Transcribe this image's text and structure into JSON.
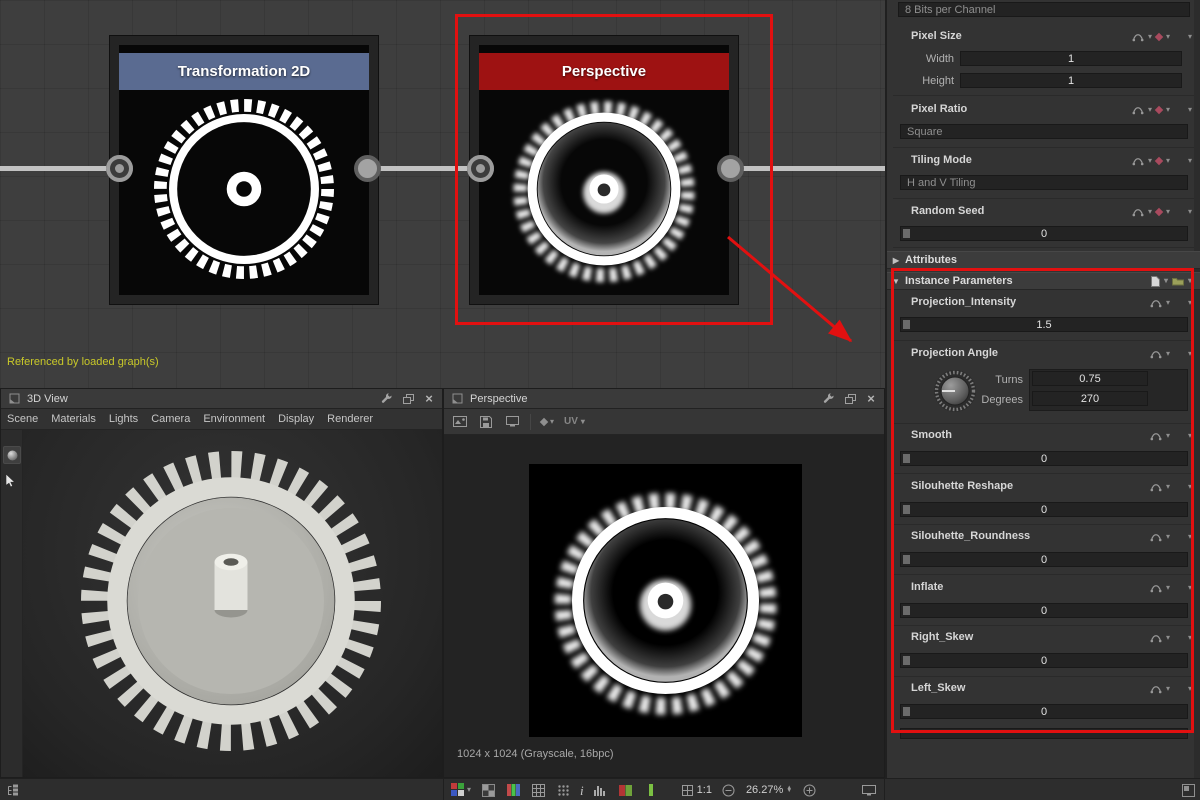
{
  "colors": {
    "annotation_red": "#e21010",
    "node1_header": "#5a6b91",
    "node2_header": "#9e1212",
    "footnote_yellow": "#c9c929"
  },
  "graph": {
    "footnote": "Referenced by loaded graph(s)",
    "nodes": [
      {
        "label": "Transformation 2D"
      },
      {
        "label": "Perspective"
      }
    ]
  },
  "panel3d": {
    "title": "3D View",
    "menu": [
      "Scene",
      "Materials",
      "Lights",
      "Camera",
      "Environment",
      "Display",
      "Renderer"
    ]
  },
  "panel2d": {
    "title": "Perspective",
    "uv_label": "UV",
    "image_info": "1024 x 1024 (Grayscale, 16bpc)",
    "pixel_ratio_label": "1:1",
    "zoom_percent": "26.27%"
  },
  "props": {
    "bits_per_channel": "8 Bits per Channel",
    "pixel_size_label": "Pixel Size",
    "width_label": "Width",
    "width_value": "1",
    "height_label": "Height",
    "height_value": "1",
    "pixel_ratio_label": "Pixel Ratio",
    "pixel_ratio_value": "Square",
    "tiling_mode_label": "Tiling Mode",
    "tiling_mode_value": "H and V Tiling",
    "random_seed_label": "Random Seed",
    "random_seed_value": "0",
    "attributes_label": "Attributes",
    "instance_parameters_label": "Instance Parameters",
    "params": [
      {
        "label": "Projection_Intensity",
        "value": "1.5"
      },
      {
        "label": "Projection Angle",
        "turns_label": "Turns",
        "turns": "0.75",
        "degrees_label": "Degrees",
        "degrees": "270"
      },
      {
        "label": "Smooth",
        "value": "0"
      },
      {
        "label": "Silouhette Reshape",
        "value": "0"
      },
      {
        "label": "Silouhette_Roundness",
        "value": "0"
      },
      {
        "label": "Inflate",
        "value": "0"
      },
      {
        "label": "Right_Skew",
        "value": "0"
      },
      {
        "label": "Left_Skew",
        "value": "0"
      }
    ]
  }
}
